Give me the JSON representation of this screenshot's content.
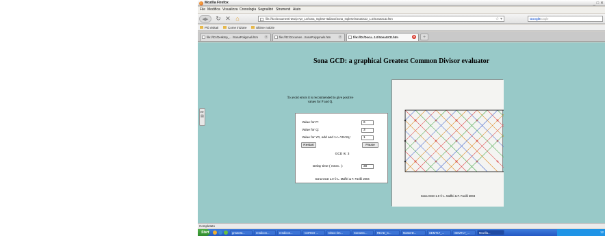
{
  "window": {
    "title": "Mozilla Firefox",
    "controls": "_ □ ✕"
  },
  "menu": {
    "items": [
      "File",
      "Modifica",
      "Visualizza",
      "Cronologia",
      "Segnalibri",
      "Strumenti",
      "Aiuto"
    ]
  },
  "nav": {
    "url": "file:///D:/Documenti-two/p Apr_14/sona_Inglese-Italiano/Sona_Inglese/SonaGCD_1.0/SonaGCD.htm",
    "search_placeholder": "Google",
    "search_engine": "Google"
  },
  "bookmarks": [
    "Più visitati",
    "Come iniziare",
    "Ultime notizie"
  ],
  "tabs": [
    {
      "label": "file:///D:/Desktop_... /SonaPoligonali.htm"
    },
    {
      "label": "file:///D:/Documen...SonaPolygonals.htm"
    },
    {
      "label": "file:///D:/Docu...1.0/SonaGCD.htm",
      "active": true
    }
  ],
  "page": {
    "heading": "Sona GCD: a graphical Greatest Common Divisor evaluator",
    "hint": "To avoid errors it is recommended to give positive values for P and Q.",
    "labels": {
      "p": "Value for P:",
      "q": "Value for Q:",
      "y0": "Value for Y0, odd and 1<=Y0<2q :",
      "delay": "Delay time ( msec. ):"
    },
    "values": {
      "p": "6",
      "q": "3",
      "y0": "1",
      "delay": "30"
    },
    "restart": "Restart",
    "pause": "Pause",
    "gcd": "GCD is: 3",
    "credit": "Sona GCD 1.0 © L. Maffei & F. Favilli 2004",
    "canvas_credit": "Sona GCD 1.0 © L. Maffei & F. Favilli 2004"
  },
  "status": "Completato",
  "taskbar": {
    "start": "Start",
    "items": [
      "greatest...",
      "rendicon...",
      "rendicon...",
      "CORSO ...",
      "Disco rim...",
      "SonaGC...",
      "READ_C...",
      "MasterD...",
      "SEMT17_...",
      "SEMT17_...",
      "Mozilla..."
    ],
    "clock": "12"
  },
  "colors": {
    "page_bg": "#98c9c8",
    "line_red": "#e05050",
    "line_green": "#48a848",
    "line_blue": "#5070d0",
    "line_orange": "#e09030",
    "frame": "#202020",
    "cross": "#d03030",
    "dot": "#303030"
  }
}
